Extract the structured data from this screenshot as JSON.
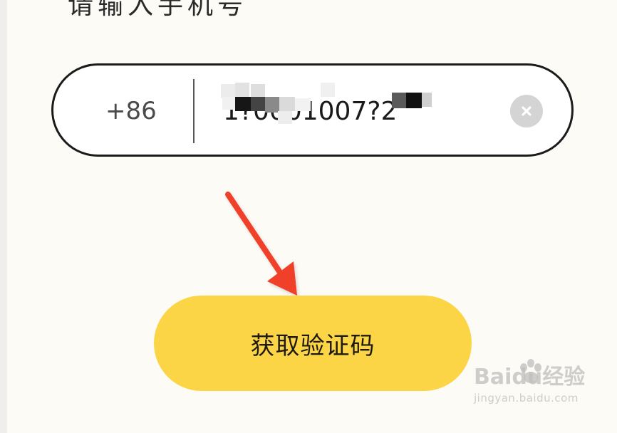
{
  "heading_fragment": "请输入手机号",
  "phone_field": {
    "country_code": "+86",
    "value": "1?0001007?2",
    "clear_icon": "close-icon"
  },
  "get_code_button": {
    "label": "获取验证码"
  },
  "annotation": {
    "arrow_color": "#f0412a",
    "arrow_icon": "arrow-down-icon"
  },
  "colors": {
    "background": "#fdfbf6",
    "button": "#fcd546",
    "field_border": "#1b1b1b"
  },
  "watermark": {
    "logo": "Baidu经验",
    "url": "jingyan.baidu.com"
  }
}
